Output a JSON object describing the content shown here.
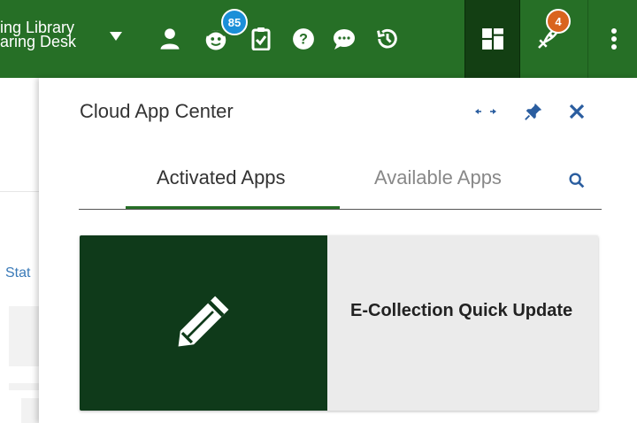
{
  "header": {
    "institution_line1": "ing Library",
    "institution_line2": "aring Desk",
    "tasks_badge": "85",
    "notifications_badge": "4",
    "colors": {
      "bar": "#266f26",
      "active_button": "#133f13",
      "badge_blue": "#1b8fd8",
      "badge_orange": "#d9641e"
    },
    "icons": [
      "chevron-down-icon",
      "user-icon",
      "tasks-icon",
      "clipboard-check-icon",
      "help-icon",
      "chat-icon",
      "history-icon",
      "layout-icon",
      "rocket-icon",
      "kebab-menu-icon"
    ]
  },
  "background": {
    "stat_text": "Stat"
  },
  "panel": {
    "title": "Cloud App Center",
    "controls": [
      "expand-icon",
      "pin-icon",
      "close-icon"
    ],
    "tabs": [
      {
        "label": "Activated Apps",
        "active": true
      },
      {
        "label": "Available Apps",
        "active": false
      }
    ],
    "apps": [
      {
        "title": "E-Collection Quick Update",
        "icon": "pencil-icon",
        "thumb_color": "#0f3a1a"
      }
    ]
  }
}
